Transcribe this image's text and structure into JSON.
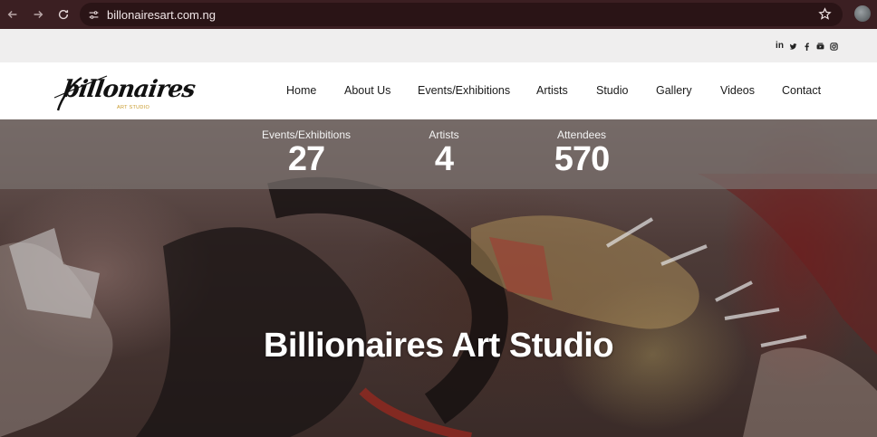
{
  "browser": {
    "url": "billonairesart.com.ng"
  },
  "social": {
    "items": [
      "in",
      "twitter",
      "facebook",
      "youtube",
      "instagram"
    ],
    "linkedin_label": "in"
  },
  "logo": {
    "text": "billonaires",
    "subtitle": "ART STUDIO"
  },
  "nav": {
    "items": [
      {
        "label": "Home"
      },
      {
        "label": "About Us"
      },
      {
        "label": "Events/Exhibitions"
      },
      {
        "label": "Artists"
      },
      {
        "label": "Studio"
      },
      {
        "label": "Gallery"
      },
      {
        "label": "Videos"
      },
      {
        "label": "Contact"
      }
    ]
  },
  "stats": [
    {
      "label": "Events/Exhibitions",
      "value": "27"
    },
    {
      "label": "Artists",
      "value": "4"
    },
    {
      "label": "Attendees",
      "value": "570"
    }
  ],
  "hero": {
    "title": "Billionaires Art Studio"
  },
  "colors": {
    "browser_bar": "#3b1f22",
    "social_bar": "#efeeee",
    "logo_accent": "#c89a2a"
  }
}
